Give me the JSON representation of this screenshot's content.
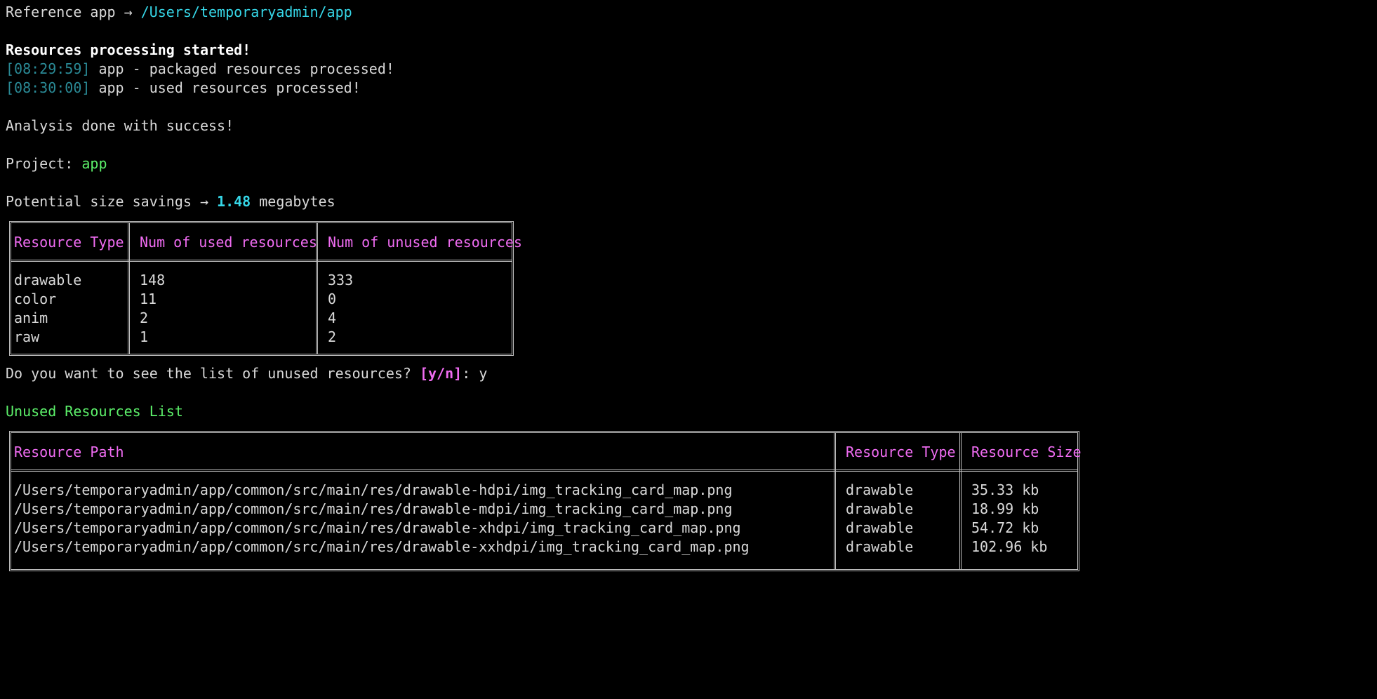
{
  "terminal": {
    "reference_line": {
      "label": "Reference app → ",
      "path": "/Users/temporaryadmin/app"
    },
    "processing_started": "Resources processing started!",
    "log_lines": [
      {
        "timestamp": "[08:29:59]",
        "message": " app - packaged resources processed!"
      },
      {
        "timestamp": "[08:30:00]",
        "message": " app - used resources processed!"
      }
    ],
    "analysis_done": "Analysis done with success!",
    "project": {
      "label": "Project: ",
      "name": "app"
    },
    "savings": {
      "label": "Potential size savings → ",
      "value": "1.48",
      "unit": " megabytes"
    },
    "summary_table": {
      "headers": [
        "Resource Type",
        "Num of used resources",
        "Num of unused resources"
      ],
      "rows": [
        [
          "drawable",
          "148",
          "333"
        ],
        [
          "color",
          "11",
          "0"
        ],
        [
          "anim",
          "2",
          "4"
        ],
        [
          "raw",
          "1",
          "2"
        ]
      ]
    },
    "prompt": {
      "question": "Do you want to see the list of unused resources? ",
      "options": "[y/n]",
      "answer": ": y"
    },
    "unused_list_title": "Unused Resources List",
    "unused_table": {
      "headers": [
        "Resource Path",
        "Resource Type",
        "Resource Size"
      ],
      "rows": [
        [
          "/Users/temporaryadmin/app/common/src/main/res/drawable-hdpi/img_tracking_card_map.png",
          "drawable",
          "35.33 kb"
        ],
        [
          "/Users/temporaryadmin/app/common/src/main/res/drawable-mdpi/img_tracking_card_map.png",
          "drawable",
          "18.99 kb"
        ],
        [
          "/Users/temporaryadmin/app/common/src/main/res/drawable-xhdpi/img_tracking_card_map.png",
          "drawable",
          "54.72 kb"
        ],
        [
          "/Users/temporaryadmin/app/common/src/main/res/drawable-xxhdpi/img_tracking_card_map.png",
          "drawable",
          "102.96 kb"
        ]
      ]
    }
  },
  "colors": {
    "background": "#000000",
    "text": "#d9d9d9",
    "path_cyan": "#36d7e8",
    "timestamp": "#2a8a96",
    "success_green": "#5cf06a",
    "header_magenta": "#f06cf2",
    "border": "#bfbfbf"
  }
}
